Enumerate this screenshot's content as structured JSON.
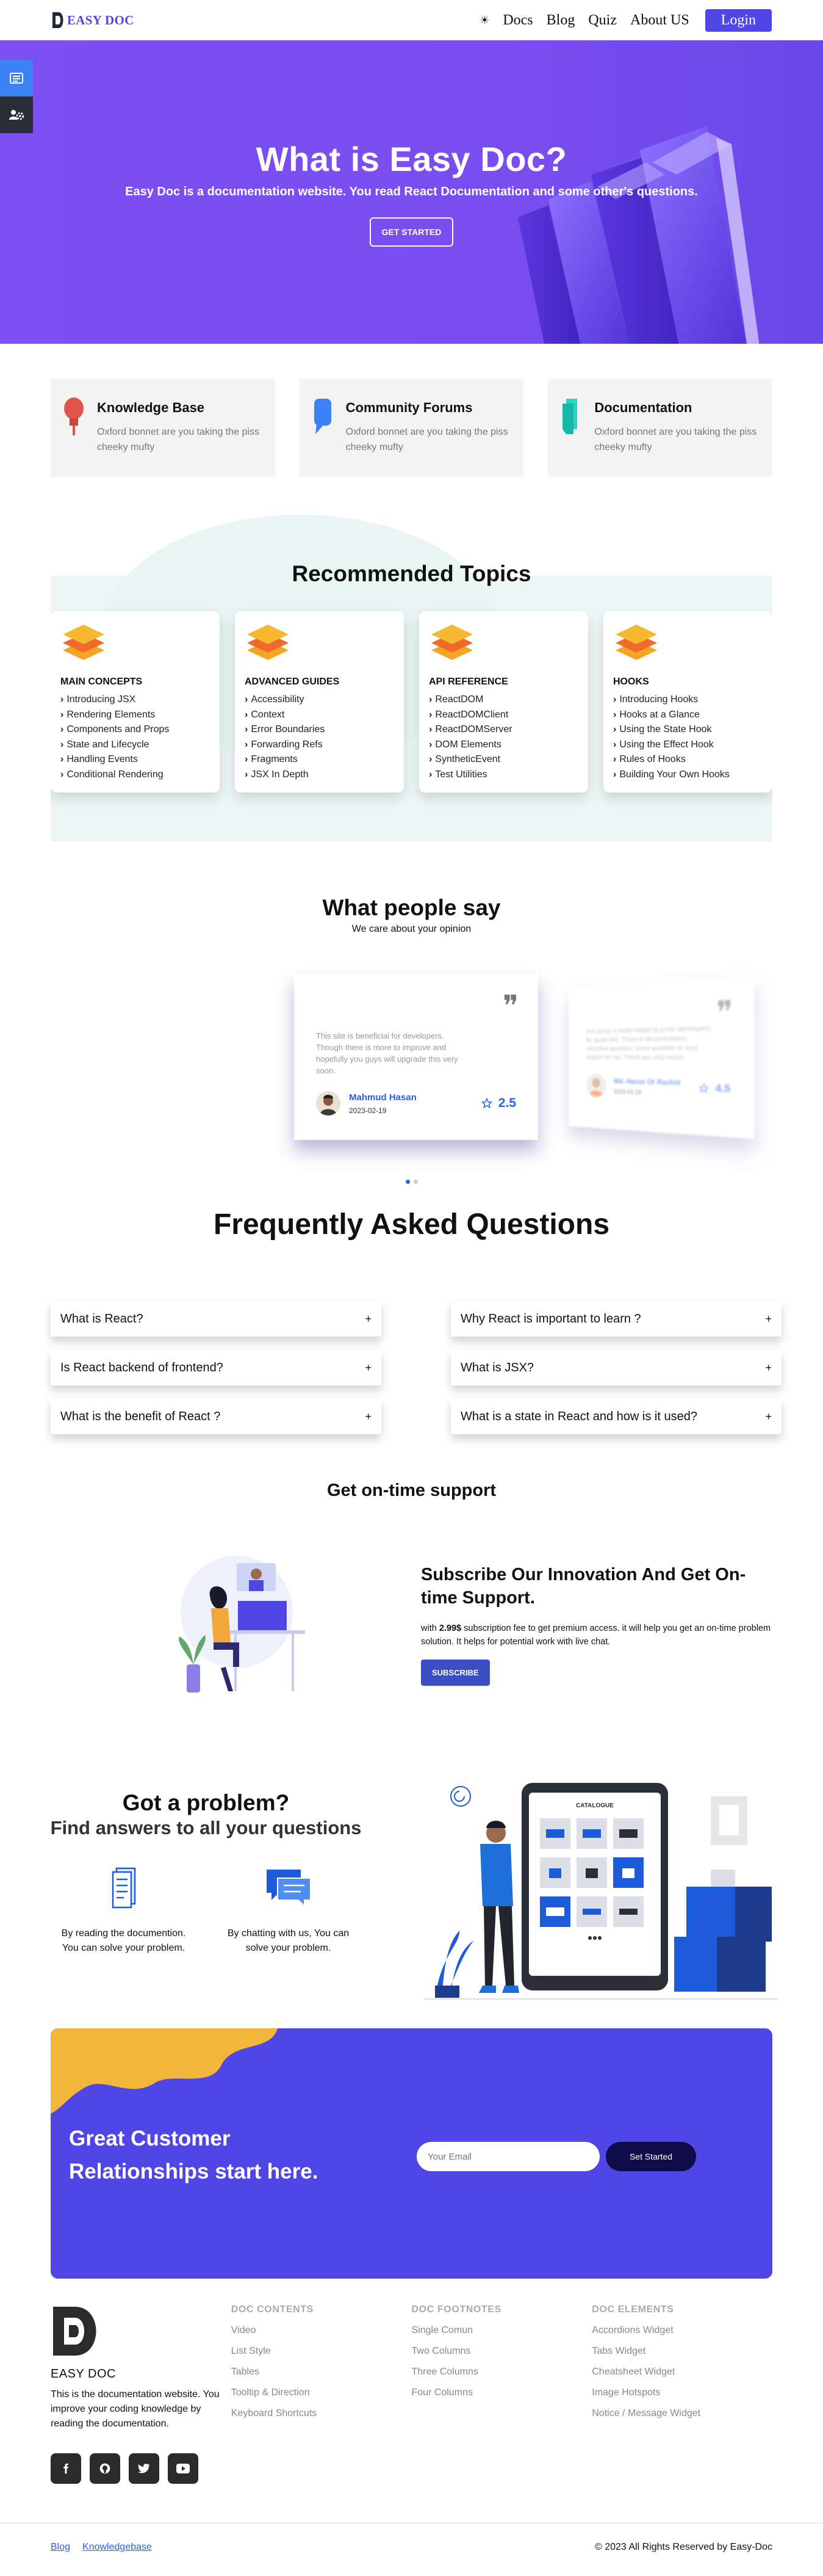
{
  "nav": {
    "logo_text": "EASY DOC",
    "links": [
      "Docs",
      "Blog",
      "Quiz",
      "About US"
    ],
    "login_label": "Login"
  },
  "hero": {
    "title": "What is Easy Doc?",
    "subtitle": "Easy Doc is a documentation website. You read React Documentation and some other's questions.",
    "cta_label": "GET STARTED"
  },
  "features": [
    {
      "title": "Knowledge Base",
      "text": "Oxford bonnet are you taking the piss cheeky mufty",
      "icon": "bulb-icon",
      "color": "#e0534a"
    },
    {
      "title": "Community Forums",
      "text": "Oxford bonnet are you taking the piss cheeky mufty",
      "icon": "chat-icon",
      "color": "#3b82f6"
    },
    {
      "title": "Documentation",
      "text": "Oxford bonnet are you taking the piss cheeky mufty",
      "icon": "document-icon",
      "color": "#2dd4bf"
    }
  ],
  "topics": {
    "title": "Recommended Topics",
    "cards": [
      {
        "heading": "MAIN CONCEPTS",
        "items": [
          "Introducing JSX",
          "Rendering Elements",
          "Components and Props",
          "State and Lifecycle",
          "Handling Events",
          "Conditional Rendering"
        ]
      },
      {
        "heading": "ADVANCED GUIDES",
        "items": [
          "Accessibility",
          "Context",
          "Error Boundaries",
          "Forwarding Refs",
          "Fragments",
          "JSX In Depth"
        ]
      },
      {
        "heading": "API REFERENCE",
        "items": [
          "ReactDOM",
          "ReactDOMClient",
          "ReactDOMServer",
          "DOM Elements",
          "SyntheticEvent",
          "Test Utilities"
        ]
      },
      {
        "heading": "HOOKS",
        "items": [
          "Introducing Hooks",
          "Hooks at a Glance",
          "Using the State Hook",
          "Using the Effect Hook",
          "Rules of Hooks",
          "Building Your Own Hooks"
        ]
      }
    ]
  },
  "testimonials": {
    "title": "What people say",
    "subtitle": "We care about your opinion",
    "items": [
      {
        "text": "This site is beneficial for developers. Though there is more to improve and hopefully you guys will upgrade this very soon.",
        "name": "Mahmud Hasan",
        "date": "2023-02-19",
        "rating": "2.5"
      },
      {
        "text": "this portal is really helpful to junior developers for guide line. There is documentation, interview question, some question to very helpful for me. Thank you very much.",
        "name": "Md. Harun Or Rashid",
        "date": "2023-03-19",
        "rating": "4.5"
      }
    ]
  },
  "faq": {
    "title": "Frequently Asked Questions",
    "items": [
      "What is React?",
      "Why React is important to learn ?",
      "Is React backend of frontend?",
      "What is JSX?",
      "What is the benefit of React ?",
      "What is a state in React and how is it used?"
    ]
  },
  "support": {
    "title": "Get on-time support",
    "heading": "Subscribe Our Innovation And Get On-time Support.",
    "text_pre": "with ",
    "price": "2.99$",
    "text_post": " subscription fee to get premium access. it will help you get an on-time problem solution. It helps for potential work with live chat.",
    "button_label": "SUBSCRIBE"
  },
  "problem": {
    "title": "Got a problem?",
    "subtitle": "Find answers to all your questions",
    "columns": [
      {
        "text": "By reading the documention. You can solve your problem.",
        "icon": "document-icon"
      },
      {
        "text": "By chatting with us, You can solve your problem.",
        "icon": "chat-icon"
      }
    ],
    "illus_label": "CATALOGUE"
  },
  "cta": {
    "title": "Great Customer Relationships start here.",
    "email_placeholder": "Your Email",
    "button_label": "Set Started"
  },
  "footer": {
    "brand_name": "EASY DOC",
    "brand_desc": "This is the documentation website. You improve your coding knowledge by reading the documentation.",
    "columns": [
      {
        "heading": "DOC CONTENTS",
        "links": [
          "Video",
          "List Style",
          "Tables",
          "Tooltip & Direction",
          "Keyboard Shortcuts"
        ]
      },
      {
        "heading": "DOC FOOTNOTES",
        "links": [
          "Single Comun",
          "Two Columns",
          "Three Columns",
          "Four Columns"
        ]
      },
      {
        "heading": "DOC ELEMENTS",
        "links": [
          "Accordions Widget",
          "Tabs Widget",
          "Cheatsheet Widget",
          "Image Hotspots",
          "Notice / Message Widget"
        ]
      }
    ],
    "bottom_links": [
      "Blog",
      "Knowledgebase"
    ],
    "copyright": "© 2023 All Rights Reserved by Easy-Doc"
  },
  "colors": {
    "accent": "#4f46e5",
    "hero": "#7c4ff0",
    "link": "#2563eb"
  }
}
